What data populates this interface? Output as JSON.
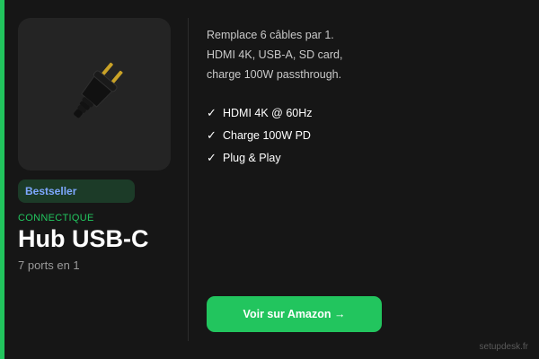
{
  "card": {
    "image": {
      "icon": "plug-icon"
    },
    "badge": "Bestseller",
    "category": "CONNECTIQUE",
    "title": "Hub USB-C",
    "subtitle": "7 ports en 1",
    "description_lines": [
      "Remplace 6 câbles par 1.",
      "HDMI 4K, USB-A, SD card,",
      "charge 100W passthrough."
    ],
    "features": [
      {
        "check": "✓",
        "label": "HDMI 4K @ 60Hz"
      },
      {
        "check": "✓",
        "label": "Charge 100W PD"
      },
      {
        "check": "✓",
        "label": "Plug & Play"
      }
    ],
    "cta_label": "Voir sur Amazon →"
  },
  "watermark": "setupdesk.fr",
  "colors": {
    "accent": "#22c55e",
    "badge_text": "#7ea8ff",
    "badge_bg": "#1c3b28",
    "background": "#161616"
  }
}
